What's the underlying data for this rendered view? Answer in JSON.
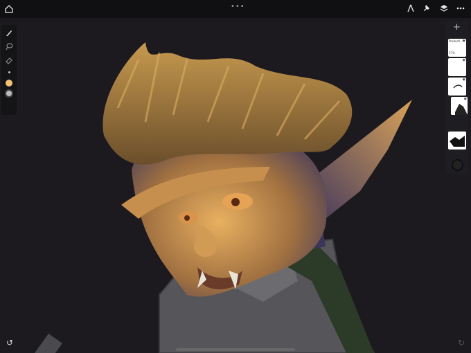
{
  "app": {
    "top_handle": "•••",
    "icons": {
      "home": "home-icon",
      "ruler": "ruler-compass-icon",
      "pin": "pin-icon",
      "layers": "layers-icon",
      "more": "more-icon"
    }
  },
  "toolbar": {
    "tools": [
      "brush-icon",
      "lasso-icon",
      "eraser-icon"
    ],
    "brush_size_indicator": "•",
    "primary_color": "#f2c275"
  },
  "layers_panel": {
    "add_label": "+",
    "top_layer_name": "Producti...",
    "top_layer_opacity": "57%",
    "layer_count": 6
  },
  "bottom": {
    "undo": "↺",
    "redo": "↻"
  },
  "colors": {
    "background": "#1c191f",
    "skin_light": "#e3a95a",
    "skin_dark": "#3a3660",
    "hair": "#b08543",
    "shirt": "#5a5a5e",
    "scarf": "#2c3a28"
  }
}
